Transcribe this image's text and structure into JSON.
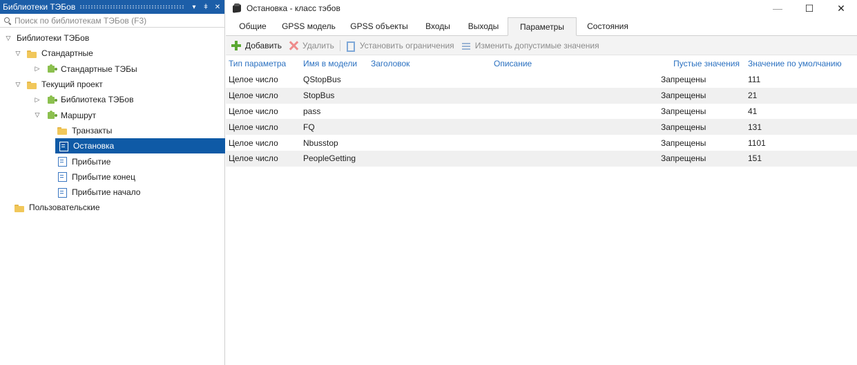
{
  "left_panel": {
    "title": "Библиотеки ТЭБов",
    "pin_glyph": "▾",
    "pin2_glyph": "ǂ",
    "close_glyph": "✕",
    "search": {
      "placeholder": "Поиск по библиотекам ТЭБов (F3)",
      "value": ""
    },
    "tree": [
      {
        "label": "Библиотеки ТЭБов",
        "expander": "▽",
        "icon": "none"
      },
      {
        "label": "Стандартные",
        "expander": "▽",
        "icon": "folder-icon"
      },
      {
        "label": "Стандартные ТЭБы",
        "expander": "▷",
        "icon": "puzzle-icon"
      },
      {
        "label": "Текущий проект",
        "expander": "▽",
        "icon": "folder-icon"
      },
      {
        "label": "Библиотека ТЭБов",
        "expander": "▷",
        "icon": "puzzle-icon"
      },
      {
        "label": "Маршрут",
        "expander": "▽",
        "icon": "puzzle-icon"
      },
      {
        "label": "Транзакты",
        "expander": "",
        "icon": "folder-icon"
      },
      {
        "label": "Остановка",
        "expander": "",
        "icon": "doc-icon",
        "selected": true
      },
      {
        "label": "Прибытие",
        "expander": "",
        "icon": "doc-icon"
      },
      {
        "label": "Прибытие конец",
        "expander": "",
        "icon": "doc-icon"
      },
      {
        "label": "Прибытие начало",
        "expander": "",
        "icon": "doc-icon"
      },
      {
        "label": "Пользовательские",
        "expander": "",
        "icon": "folder-icon"
      }
    ]
  },
  "window": {
    "title": "Остановка - класс тэбов",
    "controls": {
      "minimize": "—",
      "maximize": "☐",
      "close": "✕"
    },
    "tabs": [
      {
        "label": "Общие"
      },
      {
        "label": "GPSS модель"
      },
      {
        "label": "GPSS объекты"
      },
      {
        "label": "Входы"
      },
      {
        "label": "Выходы"
      },
      {
        "label": "Параметры",
        "active": true
      },
      {
        "label": "Состояния"
      }
    ],
    "toolbar": {
      "add": "Добавить",
      "delete": "Удалить",
      "set_limits": "Установить ограничения",
      "edit_values": "Изменить допустимые значения"
    },
    "grid": {
      "columns": [
        "Тип параметра",
        "Имя в модели",
        "Заголовок",
        "Описание",
        "Пустые значения",
        "Значение по умолчанию"
      ],
      "rows": [
        [
          "Целое число",
          "QStopBus",
          "",
          "",
          "Запрещены",
          "111"
        ],
        [
          "Целое число",
          "StopBus",
          "",
          "",
          "Запрещены",
          "21"
        ],
        [
          "Целое число",
          "pass",
          "",
          "",
          "Запрещены",
          "41"
        ],
        [
          "Целое число",
          "FQ",
          "",
          "",
          "Запрещены",
          "131"
        ],
        [
          "Целое число",
          "Nbusstop",
          "",
          "",
          "Запрещены",
          "1101"
        ],
        [
          "Целое число",
          "PeopleGetting",
          "",
          "",
          "Запрещены",
          "151"
        ]
      ]
    }
  },
  "colors": {
    "accent": "#1c5ea8",
    "selection": "#0f5aa6",
    "header_text": "#2a70c0"
  }
}
